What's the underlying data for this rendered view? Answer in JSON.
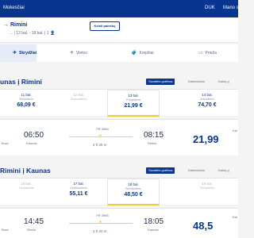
{
  "topbar": {
    "brand": "Mokesčiai",
    "currency": "DUK",
    "account": "Mano s"
  },
  "route": {
    "title": "→ Rimini",
    "details": "... | 13 bal. - 18 bal. | 1 👤",
    "edit_button": "Keisti paieškų"
  },
  "steps": [
    {
      "label": "Skrydžiai",
      "icon": "✈"
    },
    {
      "label": "Vietos",
      "icon": "✈"
    },
    {
      "label": "Krepšiai",
      "icon": "🧳"
    },
    {
      "label": "Prieža",
      "icon": "▭"
    }
  ],
  "outbound": {
    "title": "unas į Rimini",
    "tools": {
      "fares": "Savaitės grafikas",
      "calendar": "Kalendorius",
      "chart": "Kainų g"
    },
    "dates": [
      {
        "day": "11 bal.",
        "weekday": "Šeštadienis",
        "price": "68,09 €",
        "disabled": false
      },
      {
        "day": "12 bal.",
        "weekday": "Sekmadienis",
        "price": "",
        "disabled": true
      },
      {
        "day": "13 bal.",
        "weekday": "Pirmadienis",
        "price": "21,99 €",
        "disabled": false,
        "selected": true
      },
      {
        "day": "14 bal.",
        "weekday": "Antradienis",
        "price": "74,70 €",
        "disabled": false
      }
    ],
    "flight": {
      "number": "FR 3964",
      "depart_time": "06:50",
      "depart_city": "Kaunas",
      "arrive_time": "08:15",
      "arrive_city": "Rimini",
      "duration": "2 h 25 m",
      "left_mark": "Buzz",
      "price": "21,99",
      "price_label": "Kai"
    }
  },
  "inbound": {
    "title": "Rimini į Kaunas",
    "tools": {
      "fares": "Savaitės grafikas",
      "calendar": "Kalendorius",
      "chart": "Kainų g"
    },
    "dates": [
      {
        "day": "16 bal.",
        "weekday": "Trečiadienis",
        "price": "",
        "disabled": true
      },
      {
        "day": "17 bal.",
        "weekday": "Ketvirtadienis",
        "price": "55,11 €",
        "disabled": false
      },
      {
        "day": "18 bal.",
        "weekday": "Penktadienis",
        "price": "48,50 €",
        "disabled": false,
        "selected": true
      },
      {
        "day": "19 bal.",
        "weekday": "Šeštadienis",
        "price": "",
        "disabled": true
      }
    ],
    "flight": {
      "number": "FR 3965",
      "depart_time": "14:45",
      "depart_city": "Rimini",
      "arrive_time": "18:05",
      "arrive_city": "Kaunas",
      "duration": "2 h 20 m",
      "left_mark": "Buzz",
      "price": "48,5",
      "price_label": "Kai"
    }
  },
  "colors": {
    "brand_blue": "#073590",
    "accent_yellow": "#f1c933"
  }
}
